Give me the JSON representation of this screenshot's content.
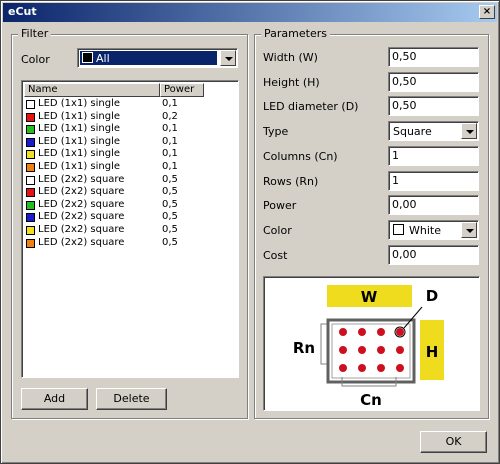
{
  "window": {
    "title": "eCut",
    "close_label": "×"
  },
  "filter": {
    "group_title": "Filter",
    "color_label": "Color",
    "color_value": "All",
    "color_swatch": "#000000",
    "columns": [
      "Name",
      "Power"
    ],
    "rows": [
      {
        "name": "LED (1x1) single",
        "power": "0,1",
        "color": "#ffffff"
      },
      {
        "name": "LED (1x1) single",
        "power": "0,2",
        "color": "#e81010"
      },
      {
        "name": "LED (1x1) single",
        "power": "0,1",
        "color": "#20c020"
      },
      {
        "name": "LED (1x1) single",
        "power": "0,1",
        "color": "#1a1ad0"
      },
      {
        "name": "LED (1x1) single",
        "power": "0,1",
        "color": "#f0e020"
      },
      {
        "name": "LED (1x1) single",
        "power": "0,1",
        "color": "#f08010"
      },
      {
        "name": "LED (2x2) square",
        "power": "0,5",
        "color": "#ffffff"
      },
      {
        "name": "LED (2x2) square",
        "power": "0,5",
        "color": "#e81010"
      },
      {
        "name": "LED (2x2) square",
        "power": "0,5",
        "color": "#20c020"
      },
      {
        "name": "LED (2x2) square",
        "power": "0,5",
        "color": "#1a1ad0"
      },
      {
        "name": "LED (2x2) square",
        "power": "0,5",
        "color": "#f0e020"
      },
      {
        "name": "LED (2x2) square",
        "power": "0,5",
        "color": "#f08010"
      }
    ],
    "add_label": "Add",
    "delete_label": "Delete"
  },
  "parameters": {
    "group_title": "Parameters",
    "width_label": "Width (W)",
    "width_value": "0,50",
    "height_label": "Height (H)",
    "height_value": "0,50",
    "led_label": "LED diameter (D)",
    "led_value": "0,50",
    "type_label": "Type",
    "type_value": "Square",
    "columns_label": "Columns (Cn)",
    "columns_value": "1",
    "rows_label": "Rows (Rn)",
    "rows_value": "1",
    "power_label": "Power",
    "power_value": "0,00",
    "color_label": "Color",
    "color_value": "White",
    "color_swatch": "#ffffff",
    "cost_label": "Cost",
    "cost_value": "0,00"
  },
  "diagram": {
    "w_label": "W",
    "h_label": "H",
    "d_label": "D",
    "rn_label": "Rn",
    "cn_label": "Cn",
    "accent": "#f0dc1e",
    "led_color": "#cc1020"
  },
  "ok_label": "OK"
}
